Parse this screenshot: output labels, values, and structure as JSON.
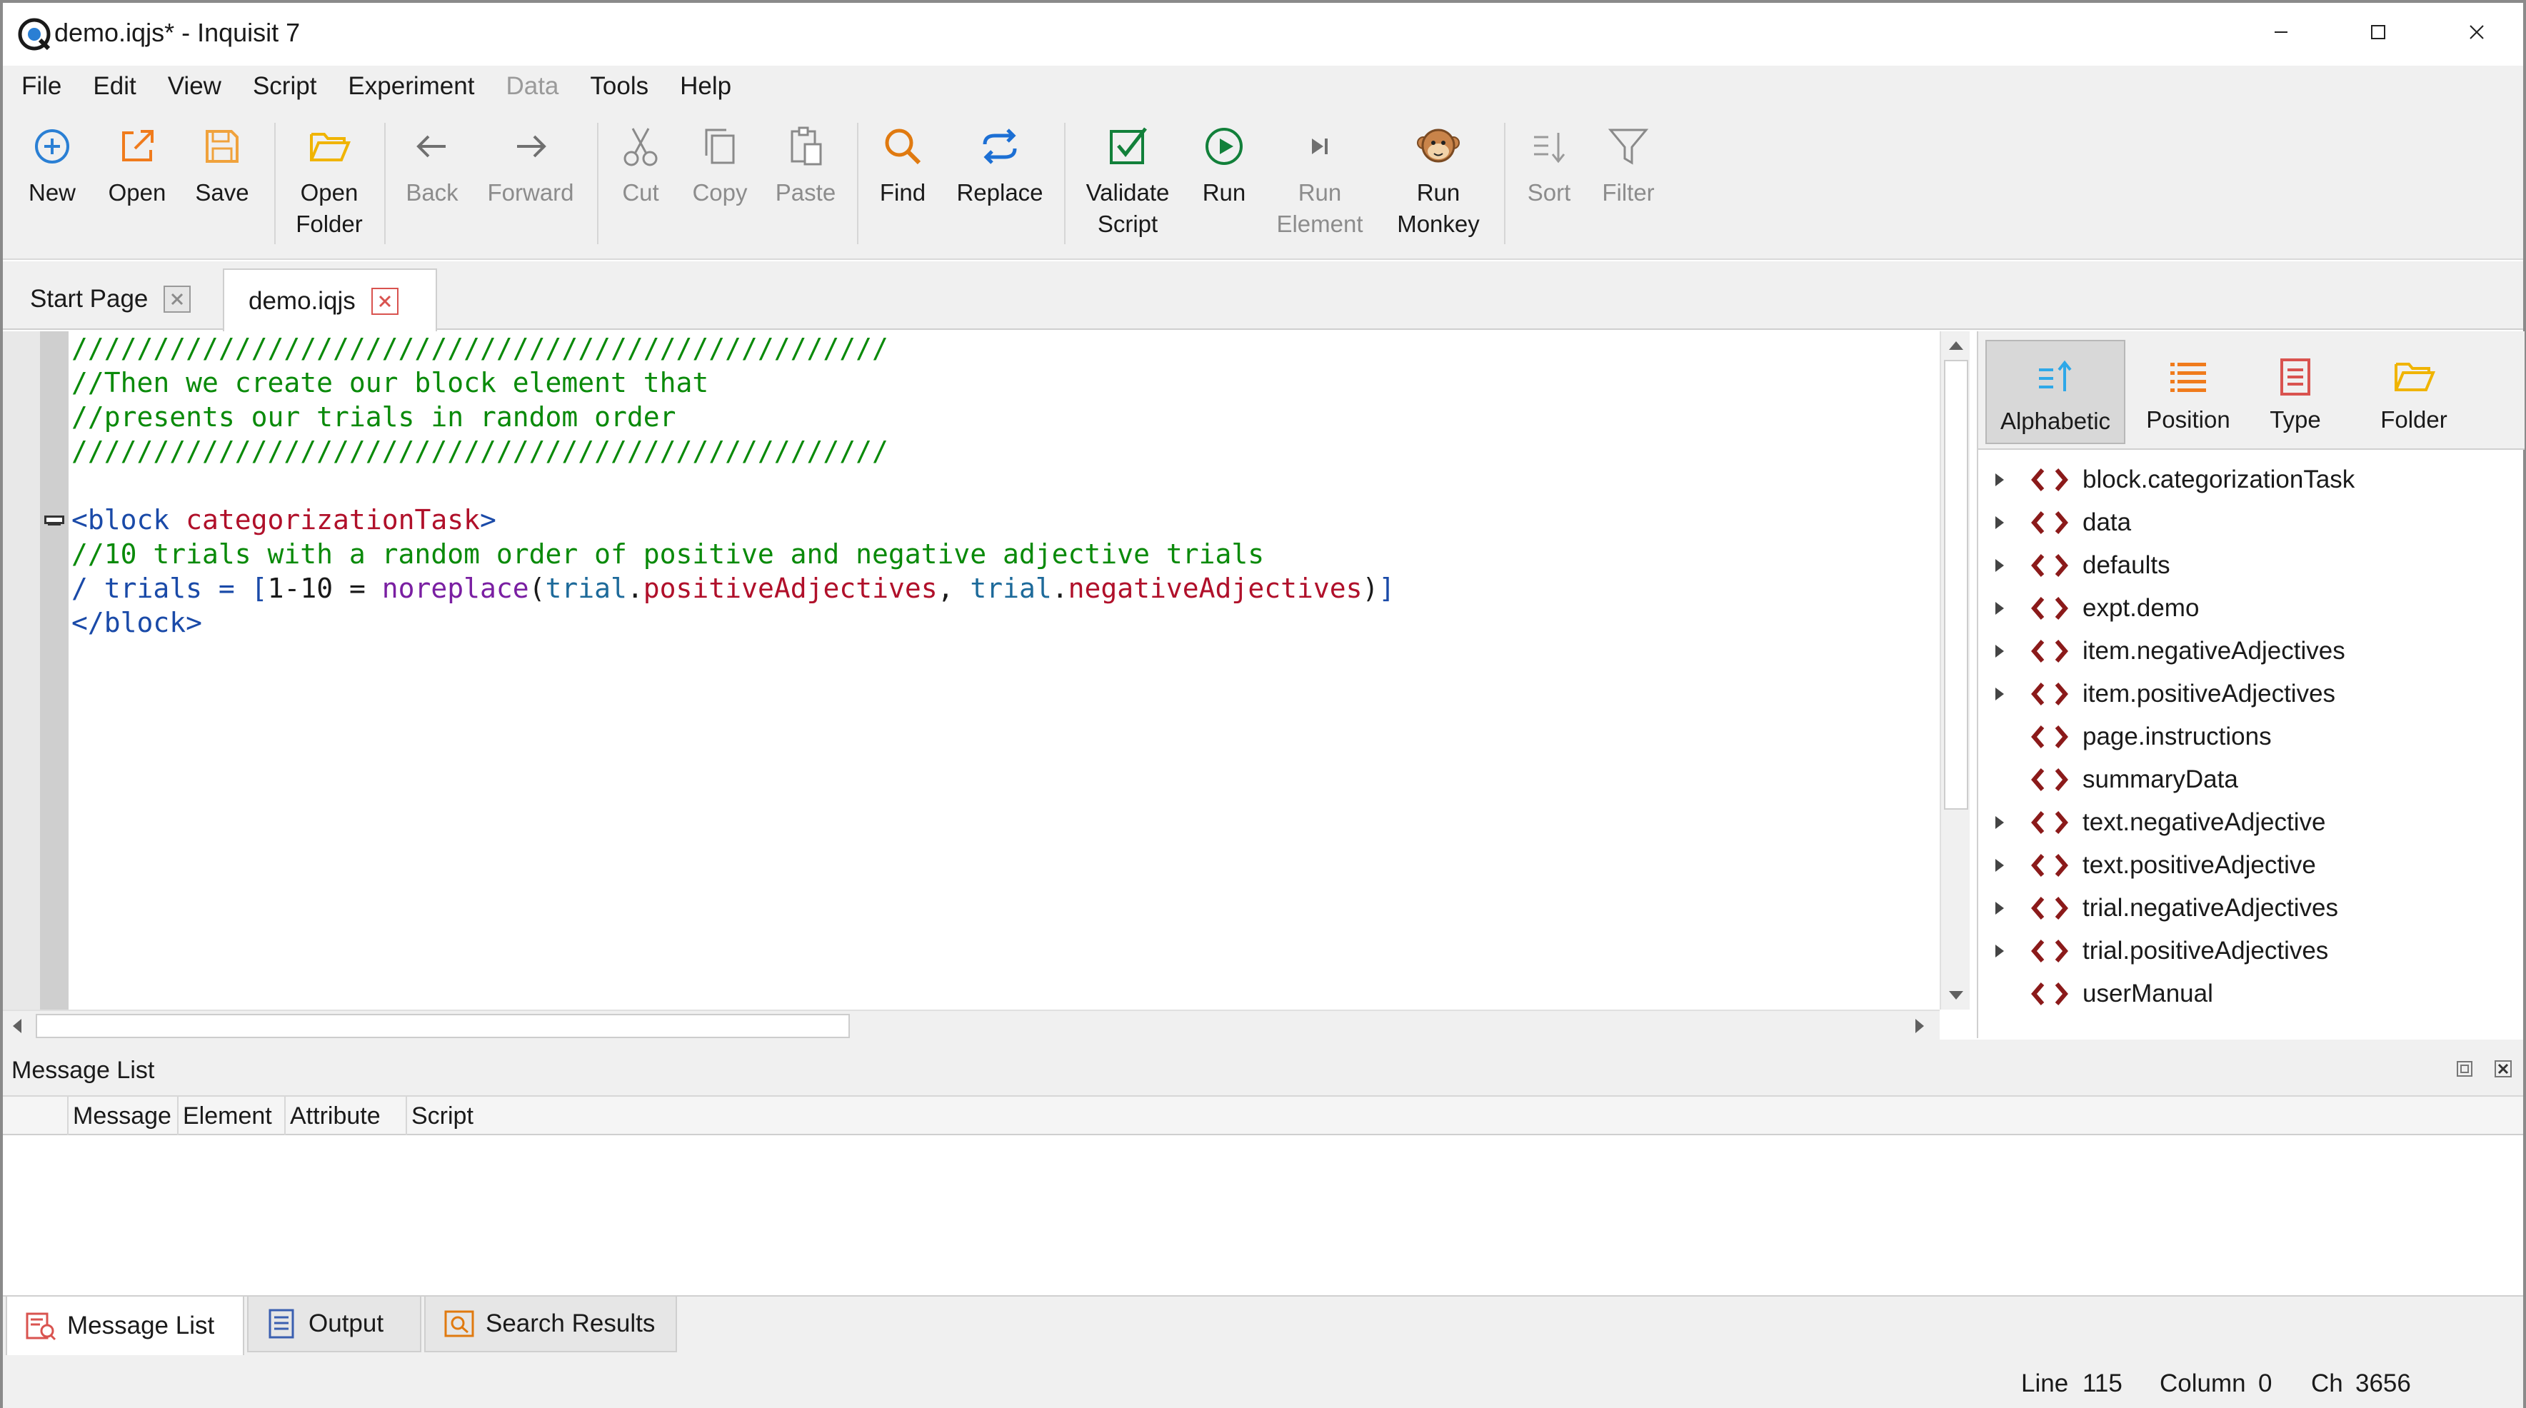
{
  "window": {
    "title": "demo.iqjs* - Inquisit 7",
    "controls": [
      "minimize",
      "maximize",
      "close"
    ]
  },
  "menu": [
    "File",
    "Edit",
    "View",
    "Script",
    "Experiment",
    "Data",
    "Tools",
    "Help"
  ],
  "toolbar": {
    "new": "New",
    "open": "Open",
    "save": "Save",
    "open_folder": "Open\nFolder",
    "back": "Back",
    "forward": "Forward",
    "cut": "Cut",
    "copy": "Copy",
    "paste": "Paste",
    "find": "Find",
    "replace": "Replace",
    "validate_script": "Validate\nScript",
    "run": "Run",
    "run_element": "Run\nElement",
    "run_monkey": "Run\nMonkey",
    "sort": "Sort",
    "filter": "Filter"
  },
  "tabs": [
    {
      "label": "Start Page",
      "active": false
    },
    {
      "label": "demo.iqjs",
      "active": true
    }
  ],
  "editor": {
    "lines": {
      "l1": "//////////////////////////////////////////////////",
      "l2": "//Then we create our block element that",
      "l3": "//presents our trials in random order",
      "l4": "//////////////////////////////////////////////////",
      "l6_open": "<block ",
      "l6_name": "categorizationTask",
      "l6_close": ">",
      "l7": "//10 trials with a random order of positive and negative adjective trials",
      "l8_a": "/ trials = ",
      "l8_b": "[",
      "l8_c": "1-10 = ",
      "l8_d": "noreplace",
      "l8_e": "(",
      "l8_f": "trial",
      "l8_g": ".",
      "l8_h": "positiveAdjectives",
      "l8_i": ", ",
      "l8_j": "trial",
      "l8_k": ".",
      "l8_l": "negativeAdjectives",
      "l8_m": ")",
      "l8_n": "]",
      "l9": "</block>"
    }
  },
  "element_panel": {
    "sort_buttons": [
      "Alphabetic",
      "Position",
      "Type",
      "Folder"
    ],
    "active_sort": "Alphabetic",
    "items": [
      {
        "label": "block.categorizationTask",
        "expandable": true
      },
      {
        "label": "data",
        "expandable": true
      },
      {
        "label": "defaults",
        "expandable": true
      },
      {
        "label": "expt.demo",
        "expandable": true
      },
      {
        "label": "item.negativeAdjectives",
        "expandable": true
      },
      {
        "label": "item.positiveAdjectives",
        "expandable": true
      },
      {
        "label": "page.instructions",
        "expandable": false
      },
      {
        "label": "summaryData",
        "expandable": false
      },
      {
        "label": "text.negativeAdjective",
        "expandable": true
      },
      {
        "label": "text.positiveAdjective",
        "expandable": true
      },
      {
        "label": "trial.negativeAdjectives",
        "expandable": true
      },
      {
        "label": "trial.positiveAdjectives",
        "expandable": true
      },
      {
        "label": "userManual",
        "expandable": false
      }
    ]
  },
  "message_list": {
    "title": "Message List",
    "columns": [
      "Message",
      "Element",
      "Attribute",
      "Script"
    ]
  },
  "bottom_tabs": [
    "Message List",
    "Output",
    "Search Results"
  ],
  "status": {
    "line_label": "Line",
    "line": "115",
    "column_label": "Column",
    "column": "0",
    "ch_label": "Ch",
    "ch": "3656"
  }
}
